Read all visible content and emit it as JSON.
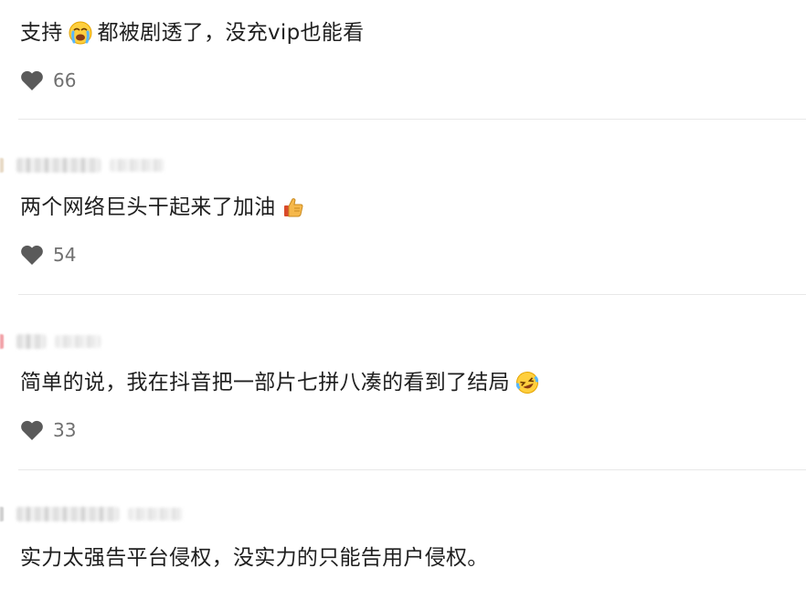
{
  "comments": [
    {
      "text_before": "支持",
      "emoji": "crying-face-emoji",
      "text_after": "都被剧透了，没充vip也能看",
      "likes": "66"
    },
    {
      "text_before": "两个网络巨头干起来了加油",
      "emoji": "thumbs-up-emoji",
      "text_after": "",
      "likes": "54"
    },
    {
      "text_before": "简单的说，我在抖音把一部片七拼八凑的看到了结局",
      "emoji": "laughing-tears-emoji",
      "text_after": "",
      "likes": "33"
    },
    {
      "text_before": "实力太强告平台侵权，没实力的只能告用户侵权。",
      "emoji": "",
      "text_after": "",
      "likes": ""
    }
  ],
  "icons": {
    "like": "heart-icon"
  },
  "colors": {
    "text": "#1f1f1f",
    "like_count": "#707070",
    "heart": "#5a5a5a",
    "divider": "#e8e8e8"
  }
}
